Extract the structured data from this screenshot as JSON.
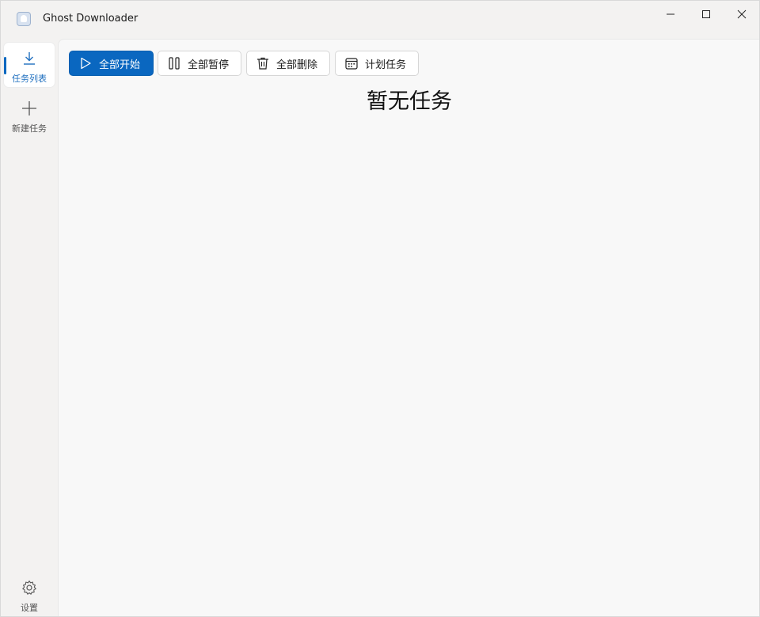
{
  "window": {
    "title": "Ghost Downloader"
  },
  "nav": {
    "tasks_label": "任务列表",
    "new_task_label": "新建任务",
    "settings_label": "设置"
  },
  "toolbar": {
    "start_all_label": "全部开始",
    "pause_all_label": "全部暂停",
    "delete_all_label": "全部删除",
    "schedule_label": "计划任务"
  },
  "main": {
    "empty_message": "暂无任务"
  },
  "colors": {
    "accent": "#0a67c0",
    "nav_label_active": "#1f6fbf"
  }
}
